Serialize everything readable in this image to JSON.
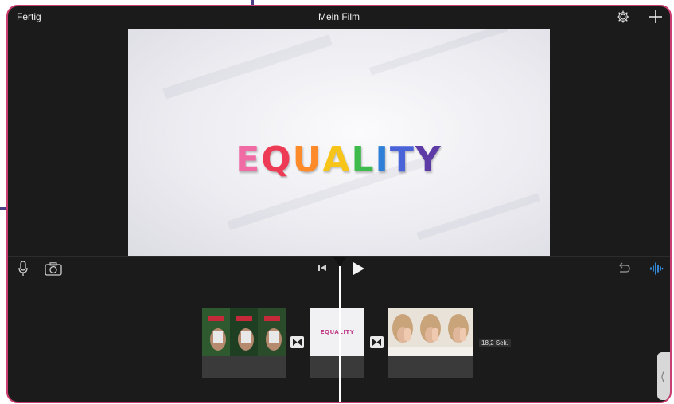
{
  "header": {
    "done_label": "Fertig",
    "title": "Mein Film",
    "settings_icon": "gear-icon",
    "add_icon": "plus-icon"
  },
  "viewer": {
    "word_letters": [
      "E",
      "Q",
      "U",
      "A",
      "L",
      "I",
      "T",
      "Y"
    ],
    "letter_colors": [
      "#f06aa3",
      "#ee3b55",
      "#ff8a2a",
      "#f7c41a",
      "#3fbb4e",
      "#2e7fd8",
      "#4b63d8",
      "#5e3aa6"
    ]
  },
  "toolbar": {
    "mic_icon": "microphone-icon",
    "camera_icon": "camera-icon",
    "skip_back_icon": "skip-to-start-icon",
    "play_icon": "play-icon",
    "undo_icon": "undo-icon",
    "audio_icon": "waveform-icon"
  },
  "timeline": {
    "clips": [
      {
        "name": "clip-1",
        "thumb_label": ""
      },
      {
        "name": "clip-2",
        "thumb_label": "EQUALITY"
      },
      {
        "name": "clip-3",
        "thumb_label": ""
      }
    ],
    "transition_icon": "bowtie-transition-icon",
    "duration_label": "18,2 Sek."
  },
  "colors": {
    "frame_border": "#c93d70",
    "background": "#1b1b1b",
    "accent_audio": "#3aa0ff"
  }
}
